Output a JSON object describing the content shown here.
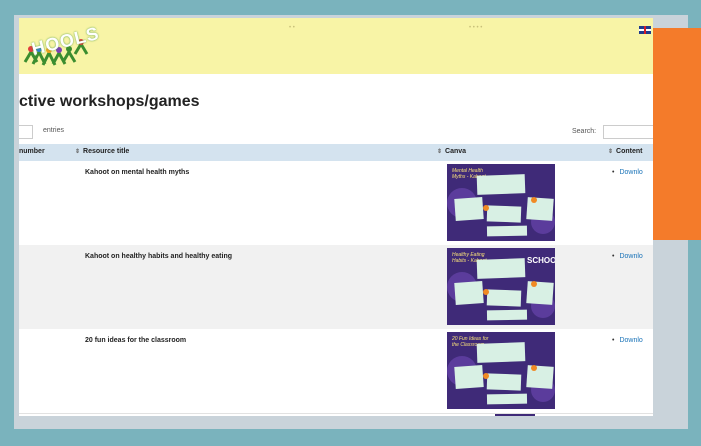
{
  "page": {
    "title": "ctive workshops/games"
  },
  "table_controls": {
    "entries_label": "entries",
    "search_label": "Search:"
  },
  "table": {
    "columns": [
      "number",
      "Resource title",
      "Canva",
      "Content"
    ],
    "rows": [
      {
        "title": "Kahoot on mental health myths",
        "thumb_title": "Mental Health Myths - Kahoot",
        "content": "Downlo"
      },
      {
        "title": "Kahoot on healthy habits and healthy eating",
        "thumb_title": "Healthy Eating Habits - Kahoot",
        "content": "Downlo"
      },
      {
        "title": "20 fun ideas for the classroom",
        "thumb_title": "20 Fun Ideas for the Classroom",
        "content": "Downlo"
      }
    ]
  },
  "banner": {
    "logo_text": "HOOLS",
    "thumb_logo": "SCHOOL"
  },
  "colors": {
    "outer_frame": "#7ab3bd",
    "banner": "#f8f4a6",
    "table_header": "#d4e3ef",
    "accent_orange": "#f47b2a",
    "link": "#1a73b8",
    "thumbnail_purple": "#3f2a78"
  },
  "icons": [
    "uk-flag-icon",
    "sort-icon",
    "bullet-icon"
  ]
}
